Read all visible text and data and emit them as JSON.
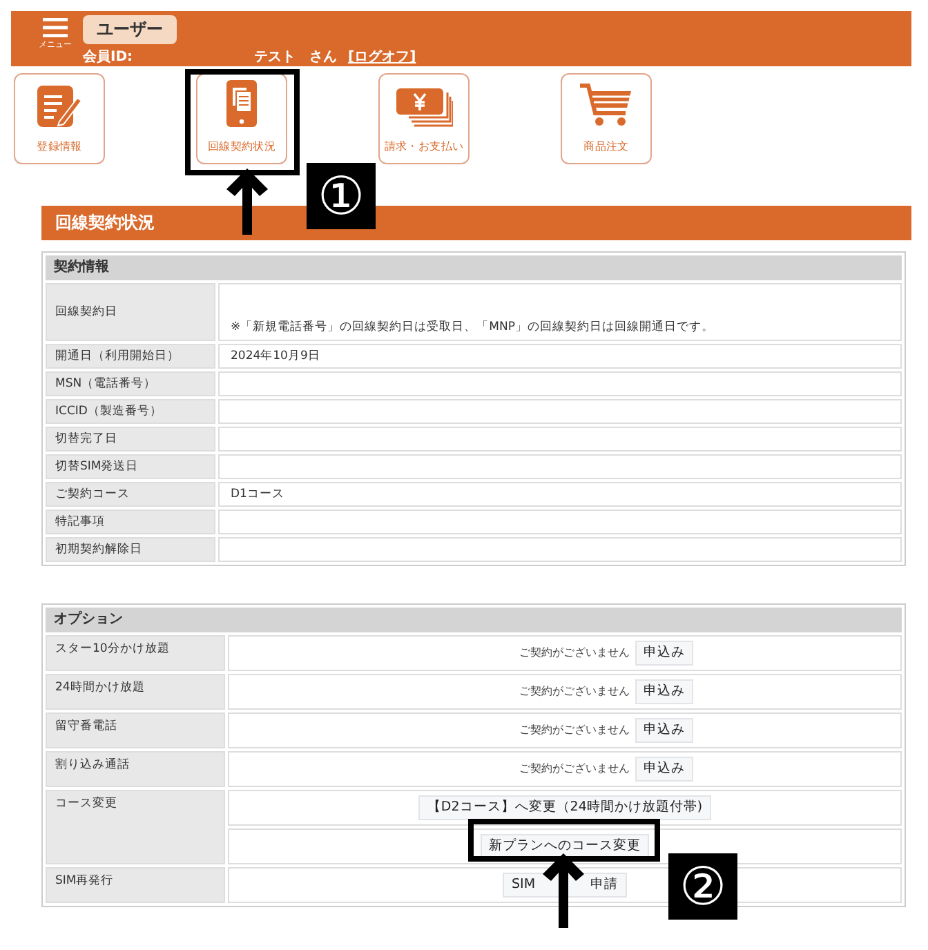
{
  "header": {
    "menu_label": "メニュー",
    "user_badge": "ユーザー",
    "member_id_label": "会員ID:",
    "user_name": "テスト　さん",
    "logout_link": "[ログオフ]"
  },
  "nav_tiles": [
    {
      "label": "登録情報",
      "kind": "form"
    },
    {
      "label": "回線契約状況",
      "kind": "tablet"
    },
    {
      "label": "請求・お支払い",
      "kind": "bills"
    },
    {
      "label": "商品注文",
      "kind": "cart"
    }
  ],
  "section_title": "回線契約状況",
  "contract": {
    "title": "契約情報",
    "rows": [
      {
        "label": "回線契約日",
        "value": "※「新規電話番号」の回線契約日は受取日、「MNP」の回線契約日は回線開通日です。",
        "kind": "tall"
      },
      {
        "label": "開通日（利用開始日）",
        "value": "2024年10月9日"
      },
      {
        "label": "MSN（電話番号）"
      },
      {
        "label": "ICCID（製造番号）"
      },
      {
        "label": "切替完了日"
      },
      {
        "label": "切替SIM発送日"
      },
      {
        "label": "ご契約コース",
        "value": "D1コース"
      },
      {
        "label": "特記事項"
      },
      {
        "label": "初期契約解除日"
      }
    ]
  },
  "options": {
    "title": "オプション",
    "rows": [
      {
        "label": "スター10分かけ放題",
        "actions": [
          {
            "status": "ご契約がございません",
            "button": "申込み"
          }
        ]
      },
      {
        "label": "24時間かけ放題",
        "actions": [
          {
            "status": "ご契約がございません",
            "button": "申込み"
          }
        ]
      },
      {
        "label": "留守番電話",
        "actions": [
          {
            "status": "ご契約がございません",
            "button": "申込み"
          }
        ]
      },
      {
        "label": "割り込み通話",
        "actions": [
          {
            "status": "ご契約がございません",
            "button": "申込み"
          }
        ]
      },
      {
        "label": "コース変更",
        "actions": [
          {
            "button": "【D2コース】へ変更（24時間かけ放題付帯)"
          },
          {
            "button": "新プランへのコース変更"
          }
        ]
      },
      {
        "label": "SIM再発行",
        "actions": [
          {
            "button_parts": [
              "SIM",
              "申請"
            ]
          }
        ]
      }
    ]
  },
  "annotations": [
    {
      "number": "①"
    },
    {
      "number": "②"
    }
  ]
}
